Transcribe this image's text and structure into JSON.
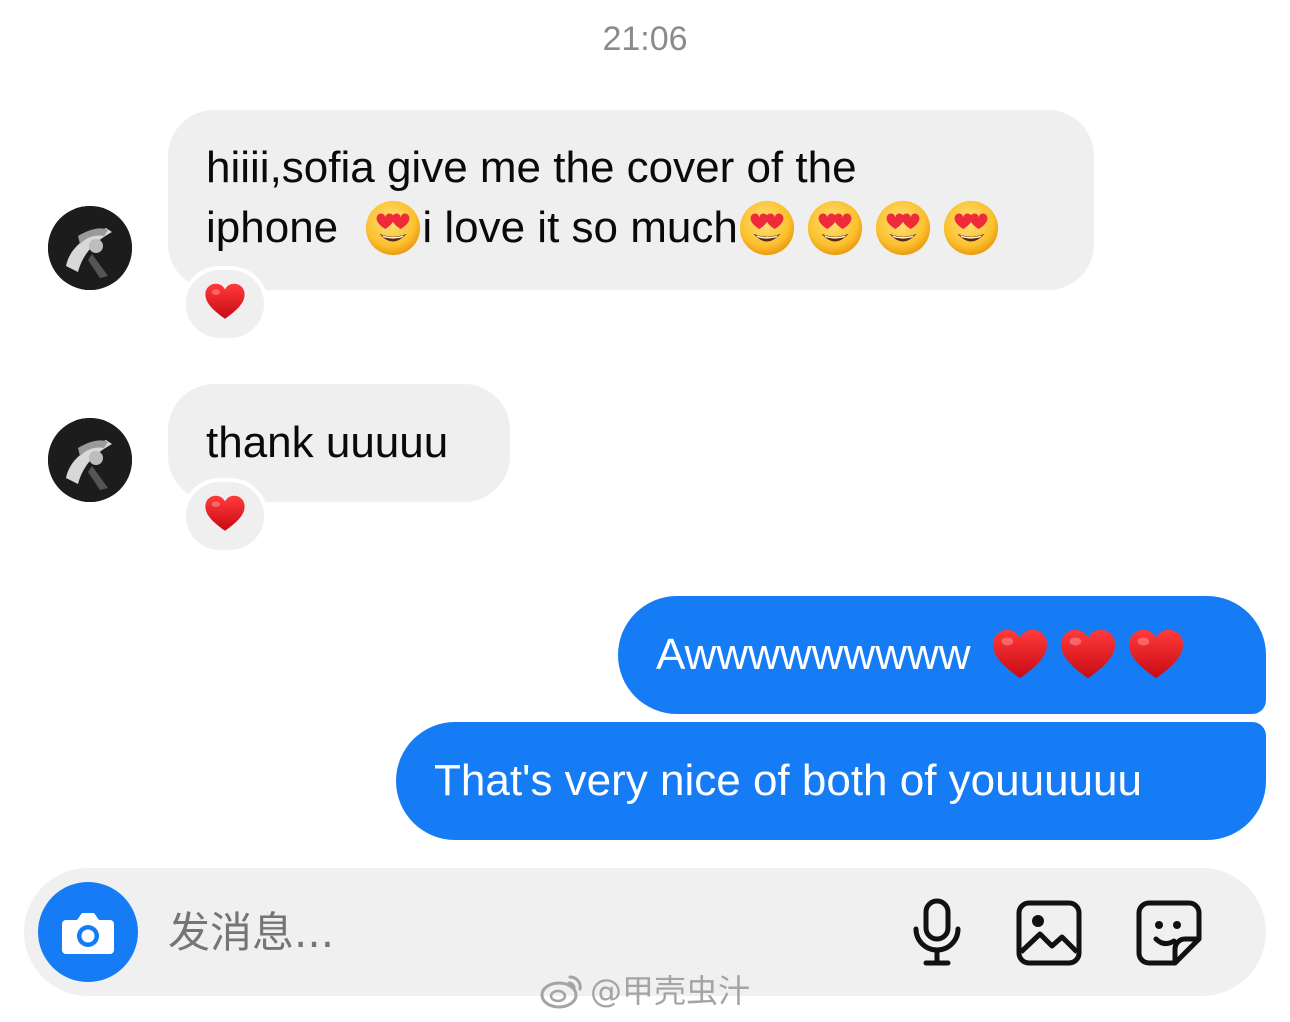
{
  "header": {
    "time": "21:06"
  },
  "messages": [
    {
      "sender": "other",
      "line1": "hiiii,sofia give me the cover of the",
      "line2_a": "iphone ",
      "line2_b": "i love it so much",
      "emojis_inline": [
        "heart-eyes",
        "heart-eyes",
        "heart-eyes",
        "heart-eyes",
        "heart-eyes"
      ],
      "reaction": "red-heart"
    },
    {
      "sender": "other",
      "text": "thank uuuuu",
      "reaction": "red-heart"
    },
    {
      "sender": "me",
      "text": "Awwwwwwwww",
      "emojis_inline": [
        "red-heart",
        "red-heart",
        "red-heart"
      ]
    },
    {
      "sender": "me",
      "text": "That's very nice of both of youuuuuu"
    }
  ],
  "composer": {
    "placeholder": "发消息...",
    "icons": [
      "camera-icon",
      "microphone-icon",
      "image-icon",
      "sticker-icon"
    ]
  },
  "watermark": {
    "text": "@甲壳虫汁"
  },
  "colors": {
    "outgoing_bubble": "#157cf6",
    "incoming_bubble": "#efefef",
    "timestamp": "#8b8b8b",
    "placeholder": "#8e8e8e"
  }
}
